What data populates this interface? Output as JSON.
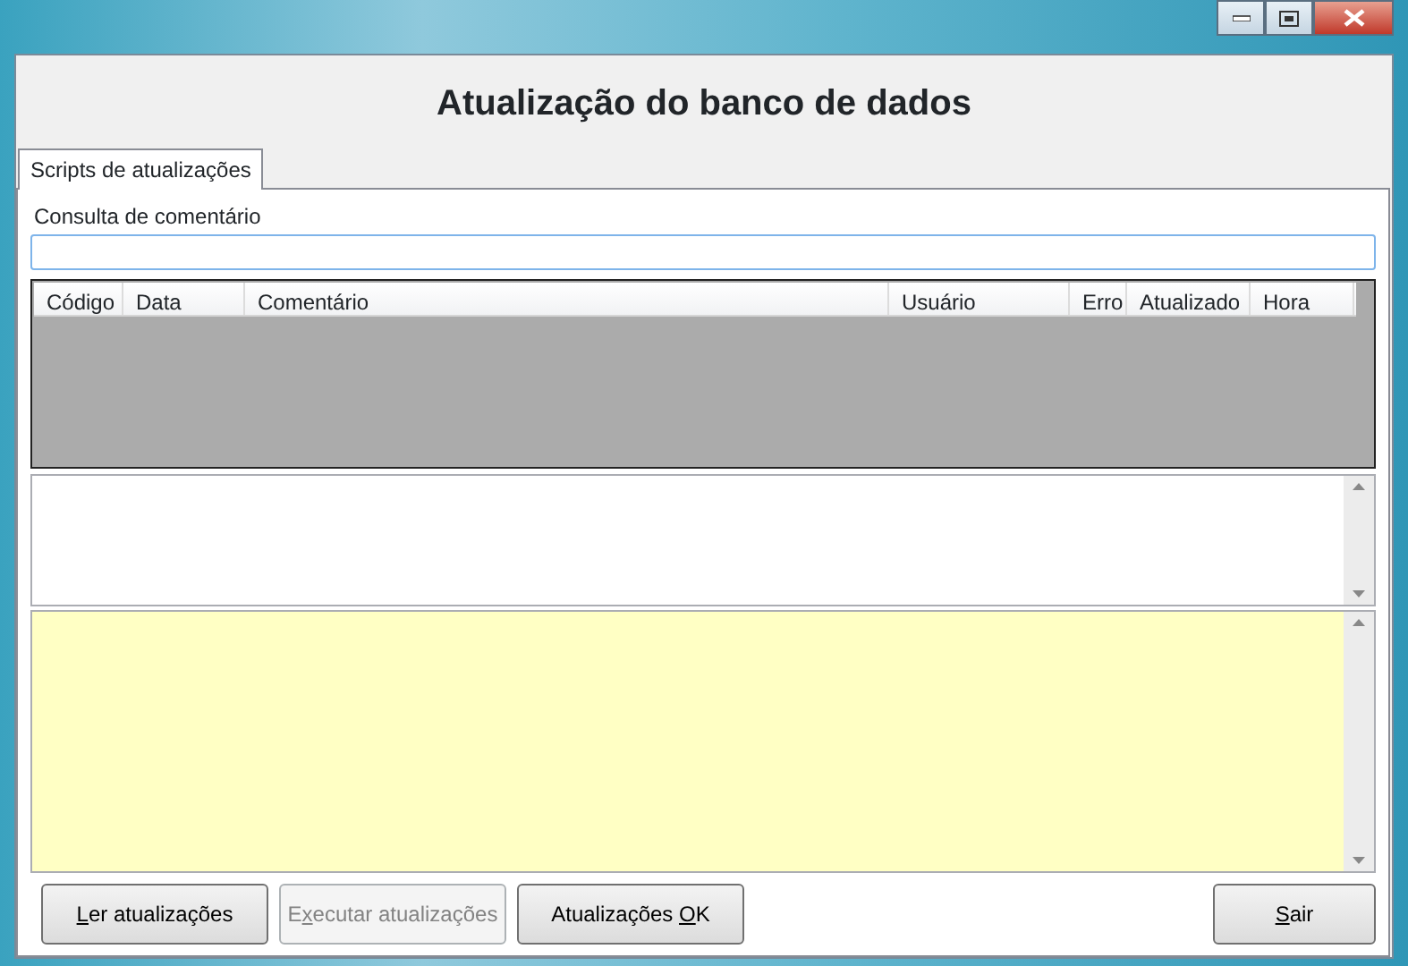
{
  "header": {
    "title": "Atualização do banco de dados"
  },
  "tabs": [
    {
      "label": "Scripts de atualizações",
      "selected": true
    }
  ],
  "search": {
    "label": "Consulta de comentário"
  },
  "grid": {
    "columns": [
      "Código",
      "Data",
      "Comentário",
      "Usuário",
      "Erro",
      "Atualizado",
      "Hora"
    ]
  },
  "buttons": [
    {
      "access_key": "L",
      "after": "er atualizações",
      "disabled": false
    },
    {
      "before": "E",
      "access_key": "x",
      "after": "ecutar atualizações",
      "disabled": true
    },
    {
      "before": "Atualizações ",
      "access_key": "O",
      "after": "K",
      "disabled": false
    },
    {
      "access_key": "S",
      "after": "air",
      "disabled": false
    }
  ]
}
